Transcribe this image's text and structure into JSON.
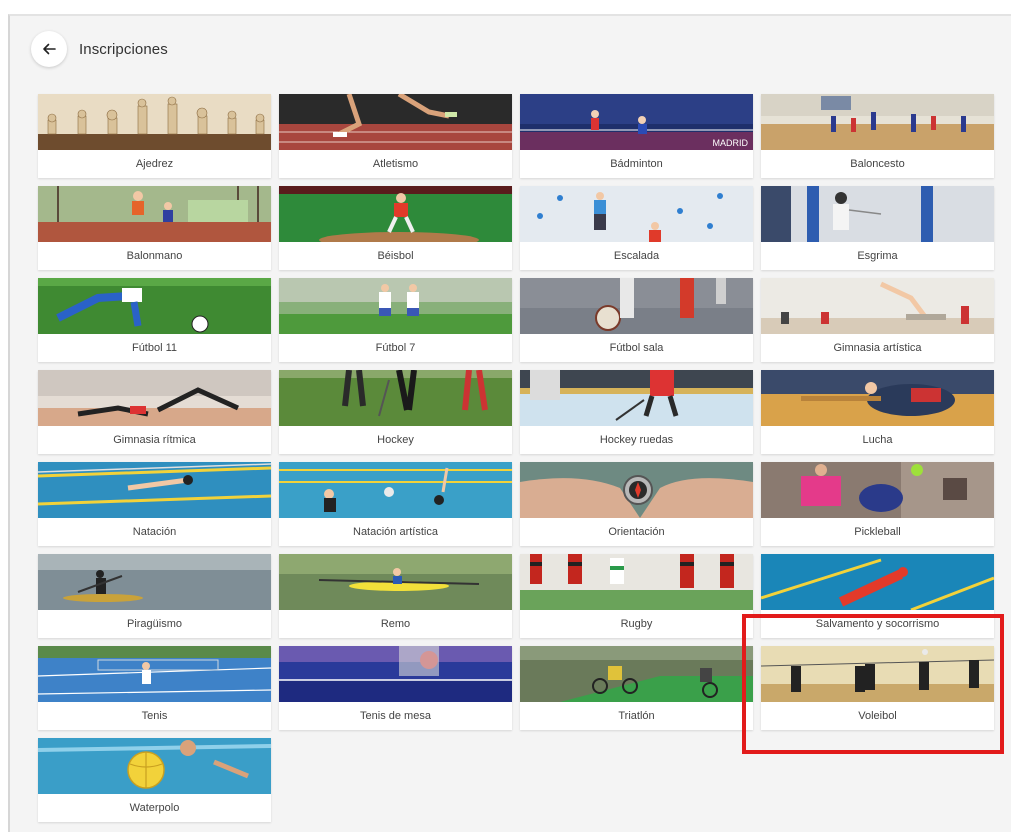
{
  "header": {
    "title": "Inscripciones",
    "back_icon": "arrow-left-icon"
  },
  "sports": [
    {
      "label": "Ajedrez",
      "image": "chess-image"
    },
    {
      "label": "Atletismo",
      "image": "athletics-image"
    },
    {
      "label": "Bádminton",
      "image": "badminton-image"
    },
    {
      "label": "Baloncesto",
      "image": "basketball-image"
    },
    {
      "label": "Balonmano",
      "image": "handball-image"
    },
    {
      "label": "Béisbol",
      "image": "baseball-image"
    },
    {
      "label": "Escalada",
      "image": "climbing-image"
    },
    {
      "label": "Esgrima",
      "image": "fencing-image"
    },
    {
      "label": "Fútbol 11",
      "image": "football-11-image"
    },
    {
      "label": "Fútbol 7",
      "image": "football-7-image"
    },
    {
      "label": "Fútbol sala",
      "image": "futsal-image"
    },
    {
      "label": "Gimnasia artística",
      "image": "artistic-gymnastics-image"
    },
    {
      "label": "Gimnasia rítmica",
      "image": "rhythmic-gymnastics-image"
    },
    {
      "label": "Hockey",
      "image": "hockey-image"
    },
    {
      "label": "Hockey ruedas",
      "image": "roller-hockey-image"
    },
    {
      "label": "Lucha",
      "image": "wrestling-image"
    },
    {
      "label": "Natación",
      "image": "swimming-image"
    },
    {
      "label": "Natación artística",
      "image": "artistic-swimming-image"
    },
    {
      "label": "Orientación",
      "image": "orienteering-image"
    },
    {
      "label": "Pickleball",
      "image": "pickleball-image"
    },
    {
      "label": "Piragüismo",
      "image": "canoeing-image"
    },
    {
      "label": "Remo",
      "image": "rowing-image"
    },
    {
      "label": "Rugby",
      "image": "rugby-image"
    },
    {
      "label": "Salvamento y socorrismo",
      "image": "lifesaving-image"
    },
    {
      "label": "Tenis",
      "image": "tennis-image"
    },
    {
      "label": "Tenis de mesa",
      "image": "table-tennis-image"
    },
    {
      "label": "Triatlón",
      "image": "triathlon-image"
    },
    {
      "label": "Voleibol",
      "image": "volleyball-image"
    },
    {
      "label": "Waterpolo",
      "image": "waterpolo-image"
    }
  ],
  "badminton_banner": "MADRID",
  "highlight_color": "#e21b1b"
}
